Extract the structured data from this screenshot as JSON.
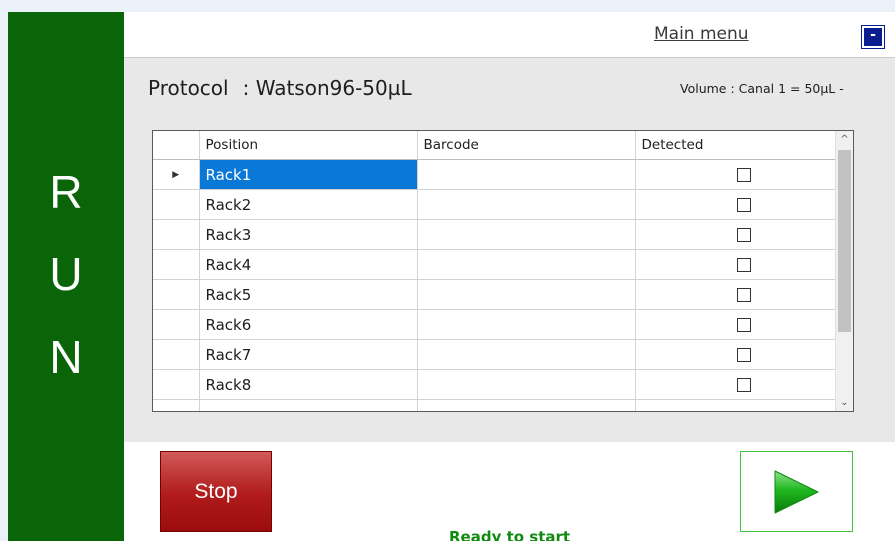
{
  "side": {
    "letters": [
      "R",
      "U",
      "N"
    ],
    "color": "#0a6408"
  },
  "topbar": {
    "main_menu": "Main menu",
    "minimize": "-"
  },
  "protocol": {
    "label": "Protocol",
    "value": ": Watson96-50µL"
  },
  "volume": {
    "text": "Volume : Canal 1 = 50µL -"
  },
  "grid": {
    "columns": [
      "Position",
      "Barcode",
      "Detected"
    ],
    "rows": [
      {
        "position": "Rack1",
        "barcode": "",
        "detected": false,
        "selected": true
      },
      {
        "position": "Rack2",
        "barcode": "",
        "detected": false
      },
      {
        "position": "Rack3",
        "barcode": "",
        "detected": false
      },
      {
        "position": "Rack4",
        "barcode": "",
        "detected": false
      },
      {
        "position": "Rack5",
        "barcode": "",
        "detected": false
      },
      {
        "position": "Rack6",
        "barcode": "",
        "detected": false
      },
      {
        "position": "Rack7",
        "barcode": "",
        "detected": false
      },
      {
        "position": "Rack8",
        "barcode": "",
        "detected": false
      }
    ],
    "selection_color": "#0a78d7"
  },
  "buttons": {
    "stop": "Stop"
  },
  "status": {
    "text": "Ready to start",
    "color": "#118a11"
  },
  "icons": {
    "row_pointer": "triangle-right-icon",
    "play": "play-icon",
    "scroll_up": "chevron-up-icon",
    "scroll_down": "chevron-down-icon"
  }
}
